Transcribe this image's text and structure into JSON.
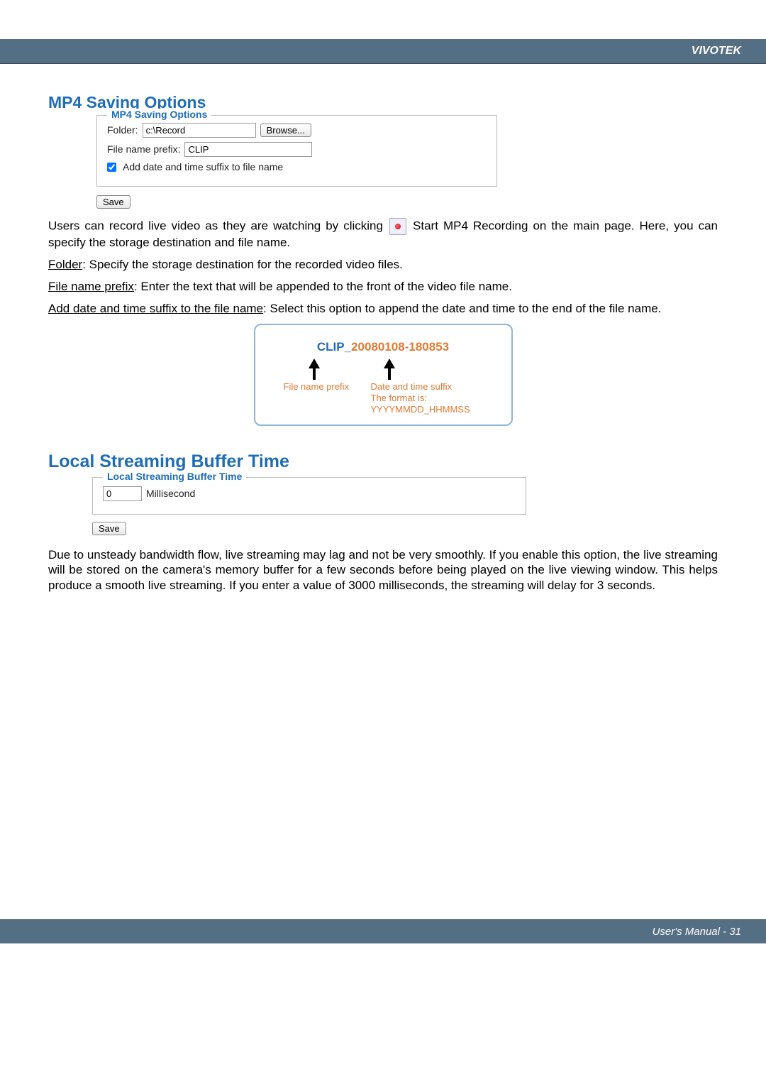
{
  "header": {
    "brand": "VIVOTEK"
  },
  "mp4": {
    "heading": "MP4 Saving Options",
    "legend": "MP4 Saving Options",
    "folder_label": "Folder:",
    "folder_value": "c:\\Record",
    "browse_label": "Browse...",
    "prefix_label": "File name prefix:",
    "prefix_value": "CLIP",
    "suffix_checkbox_label": "Add date and time suffix to file name",
    "save_label": "Save"
  },
  "mp4_desc": {
    "p1a": "Users can record live video as they are watching by clicking ",
    "p1b": " Start MP4 Recording on the main page. Here, you can specify the storage destination and file name.",
    "folder_term": "Folder",
    "folder_def": ": Specify the storage destination for the recorded video files.",
    "prefix_term": "File name prefix",
    "prefix_def": ": Enter the text that will be appended to the front of the video file name.",
    "suffix_term": "Add date and time suffix to the file name",
    "suffix_def": ": Select this option to append the date and time to the end of the file name."
  },
  "example": {
    "prefix": "CLIP_",
    "suffix": "20080108-180853",
    "label_prefix": "File name prefix",
    "label_suffix": "Date and time suffix",
    "label_format": "The format is: YYYYMMDD_HHMMSS"
  },
  "buffer": {
    "heading": "Local Streaming Buffer Time",
    "legend": "Local Streaming Buffer Time",
    "value": "0",
    "unit": "Millisecond",
    "save_label": "Save",
    "desc": "Due to unsteady bandwidth flow, live streaming may lag and not be very smoothly. If you enable this option, the live streaming will be stored on the camera's memory buffer for a few seconds before being played on the live viewing window. This helps produce a smooth live streaming. If you enter a value of 3000 milliseconds, the streaming will delay for 3 seconds."
  },
  "footer": {
    "text": "User's Manual - 31"
  }
}
